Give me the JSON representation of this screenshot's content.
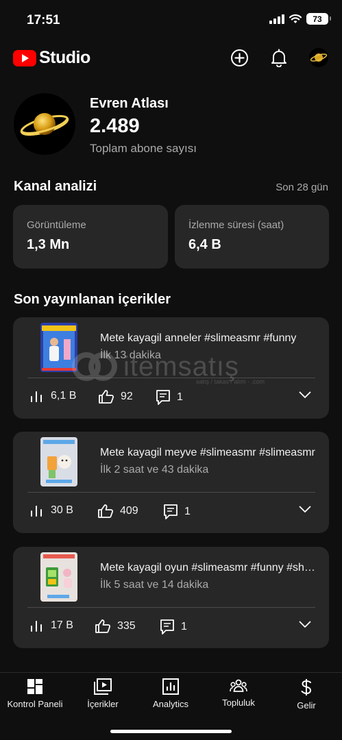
{
  "status_bar": {
    "time": "17:51",
    "battery": "73"
  },
  "header": {
    "logo_text": "Studio",
    "icons": [
      "create-icon",
      "bell-icon",
      "channel-avatar-icon"
    ]
  },
  "channel": {
    "name": "Evren Atlası",
    "subscriber_count": "2.489",
    "subscriber_label": "Toplam abone sayısı"
  },
  "analytics": {
    "title": "Kanal analizi",
    "period": "Son 28 gün",
    "cards": [
      {
        "label": "Görüntüleme",
        "value": "1,3 Mn"
      },
      {
        "label": "İzlenme süresi (saat)",
        "value": "6,4 B"
      }
    ]
  },
  "recent": {
    "title": "Son yayınlanan içerikler",
    "videos": [
      {
        "title": "Mete kayagil anneler #slimeasmr  #funny",
        "time": "İlk 13 dakika",
        "views": "6,1 B",
        "likes": "92",
        "comments": "1"
      },
      {
        "title": "Mete kayagil meyve #slimeasmr #slimeasmr",
        "time": "İlk 2 saat ve 43 dakika",
        "views": "30 B",
        "likes": "409",
        "comments": "1"
      },
      {
        "title": "Mete kayagil oyun #slimeasmr #funny #shorts",
        "time": "İlk 5 saat ve 14 dakika",
        "views": "17 B",
        "likes": "335",
        "comments": "1"
      }
    ]
  },
  "watermark": {
    "text": "itemsatış",
    "sub": "satış / takas / alım · .com"
  },
  "bottom_nav": [
    {
      "label": "Kontrol Paneli",
      "icon": "dashboard-icon"
    },
    {
      "label": "İçerikler",
      "icon": "content-icon"
    },
    {
      "label": "Analytics",
      "icon": "analytics-icon"
    },
    {
      "label": "Topluluk",
      "icon": "community-icon"
    },
    {
      "label": "Gelir",
      "icon": "earn-icon"
    }
  ],
  "colors": {
    "background": "#0f0f0f",
    "card": "#272727",
    "brand_red": "#ff0000",
    "muted_text": "#aaaaaa"
  }
}
